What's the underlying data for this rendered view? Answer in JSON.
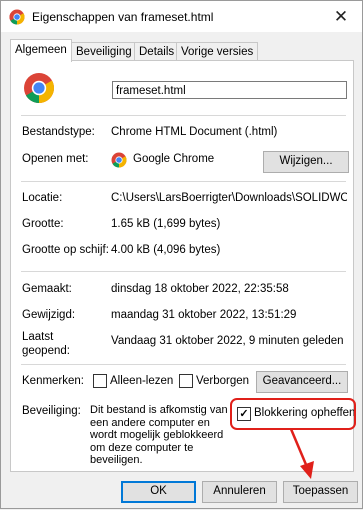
{
  "window": {
    "title": "Eigenschappen van frameset.html",
    "close_glyph": "✕"
  },
  "tabs": [
    {
      "label": "Algemeen",
      "active": true
    },
    {
      "label": "Beveiliging",
      "active": false
    },
    {
      "label": "Details",
      "active": false
    },
    {
      "label": "Vorige versies",
      "active": false
    }
  ],
  "general": {
    "file_name": "frameset.html",
    "file_type_label": "Bestandstype:",
    "file_type_value": "Chrome HTML Document (.html)",
    "opens_with_label": "Openen met:",
    "opens_with_value": "Google Chrome",
    "change_button": "Wijzigen...",
    "location_label": "Locatie:",
    "location_value": "C:\\Users\\LarsBoerrigter\\Downloads\\SOLIDWOR",
    "size_label": "Grootte:",
    "size_value": "1.65 kB (1,699 bytes)",
    "size_on_disk_label": "Grootte op schijf:",
    "size_on_disk_value": "4.00 kB (4,096 bytes)",
    "created_label": "Gemaakt:",
    "created_value": "dinsdag 18 oktober 2022, 22:35:58",
    "modified_label": "Gewijzigd:",
    "modified_value": "maandag 31 oktober 2022, 13:51:29",
    "accessed_label_1": "Laatst",
    "accessed_label_2": "geopend:",
    "accessed_value": "Vandaag 31 oktober 2022, 9 minuten geleden",
    "attributes_label": "Kenmerken:",
    "readonly_label": "Alleen-lezen",
    "readonly_checked": false,
    "hidden_label": "Verborgen",
    "hidden_checked": false,
    "advanced_button": "Geavanceerd...",
    "security_label": "Beveiliging:",
    "security_text_lines": [
      "Dit bestand is afkomstig van",
      "een andere computer en",
      "wordt mogelijk geblokkeerd",
      "om deze computer te",
      "beveiligen."
    ],
    "unblock_label": "Blokkering opheffen",
    "unblock_checked": true,
    "check_glyph": "✓"
  },
  "footer": {
    "ok": "OK",
    "cancel": "Annuleren",
    "apply": "Toepassen"
  },
  "colors": {
    "annotation_red": "#e0201a",
    "default_button_border": "#0078d7"
  },
  "icons": {
    "app": "chrome-logo-icon",
    "close": "close-icon"
  }
}
